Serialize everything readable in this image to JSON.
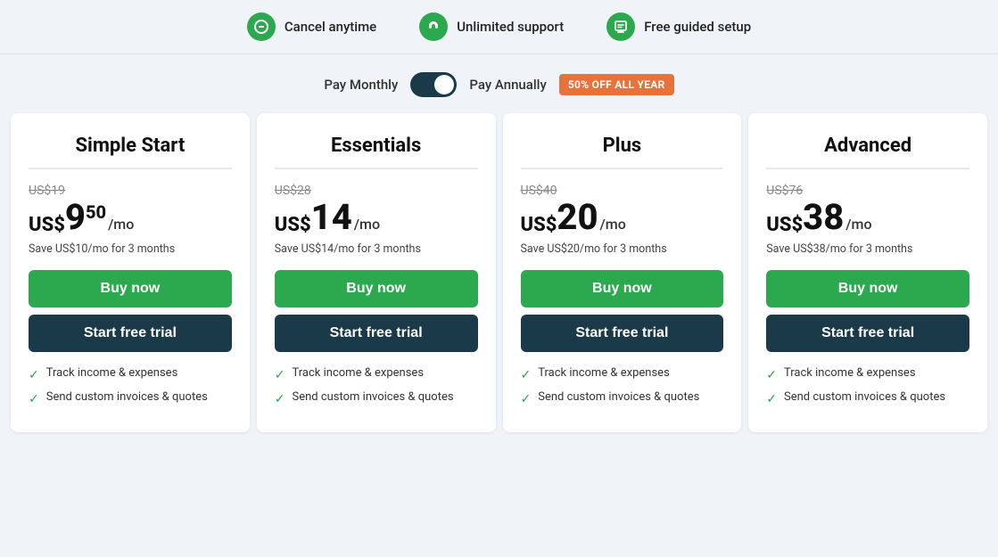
{
  "banner": {
    "items": [
      {
        "icon": "cancel-icon",
        "icon_char": "⊘",
        "label": "Cancel anytime"
      },
      {
        "icon": "support-icon",
        "icon_char": "📣",
        "label": "Unlimited support"
      },
      {
        "icon": "setup-icon",
        "icon_char": "🎓",
        "label": "Free guided setup"
      }
    ]
  },
  "billing_toggle": {
    "monthly_label": "Pay Monthly",
    "annual_label": "Pay Annually",
    "discount_badge": "50% OFF ALL YEAR"
  },
  "plans": [
    {
      "name": "Simple Start",
      "original_price": "US$19",
      "price_prefix": "US$",
      "price_main": "9",
      "price_sup": "50",
      "price_period": "/mo",
      "savings": "Save US$10/mo for 3 months",
      "buy_label": "Buy now",
      "trial_label": "Start free trial",
      "features": [
        "Track income & expenses",
        "Send custom invoices & quotes"
      ]
    },
    {
      "name": "Essentials",
      "original_price": "US$28",
      "price_prefix": "US$",
      "price_main": "14",
      "price_sup": "",
      "price_period": "/mo",
      "savings": "Save US$14/mo for 3 months",
      "buy_label": "Buy now",
      "trial_label": "Start free trial",
      "features": [
        "Track income & expenses",
        "Send custom invoices & quotes"
      ]
    },
    {
      "name": "Plus",
      "original_price": "US$40",
      "price_prefix": "US$",
      "price_main": "20",
      "price_sup": "",
      "price_period": "/mo",
      "savings": "Save US$20/mo for 3 months",
      "buy_label": "Buy now",
      "trial_label": "Start free trial",
      "features": [
        "Track income & expenses",
        "Send custom invoices & quotes"
      ]
    },
    {
      "name": "Advanced",
      "original_price": "US$76",
      "price_prefix": "US$",
      "price_main": "38",
      "price_sup": "",
      "price_period": "/mo",
      "savings": "Save US$38/mo for 3 months",
      "buy_label": "Buy now",
      "trial_label": "Start free trial",
      "features": [
        "Track income & expenses",
        "Send custom invoices & quotes"
      ]
    }
  ]
}
